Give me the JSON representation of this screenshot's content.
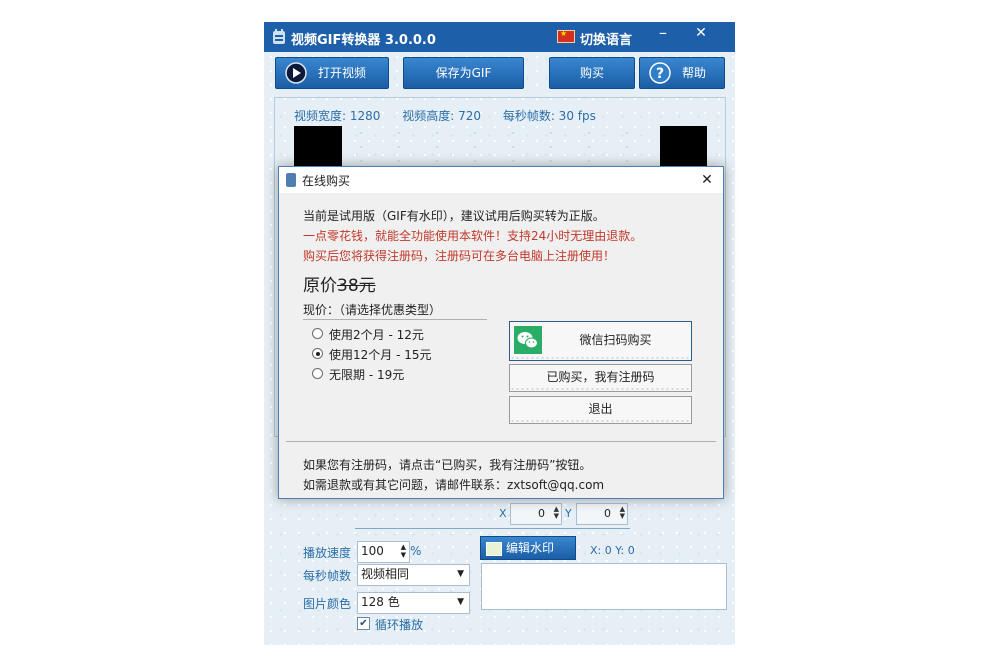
{
  "window": {
    "title": "视频GIF转换器 3.0.0.0",
    "lang_label": "切换语言",
    "minimize_glyph": "–",
    "close_glyph": "✕",
    "flag_color": "#d62e1f"
  },
  "toolbar": {
    "open_label": "打开视频",
    "save_label": "保存为GIF",
    "buy_label": "购买",
    "help_label": "帮助",
    "open_icon": "play-circle-icon",
    "help_icon": "question-circle-icon",
    "accent": "#1a5ea6"
  },
  "video_info": {
    "width_text": "视频宽度: 1280",
    "height_text": "视频高度: 720",
    "fps_text": "每秒帧数: 30 fps"
  },
  "position": {
    "x_label": "X",
    "x_value": "0",
    "y_label": "Y",
    "y_value": "0"
  },
  "settings": {
    "speed_label": "播放速度",
    "speed_value": "100",
    "speed_unit": "%",
    "fps_label": "每秒帧数",
    "fps_value": "视频相同",
    "color_label": "图片颜色",
    "color_value": "128 色",
    "loop_label": "循环播放",
    "loop_checked": true
  },
  "watermark": {
    "button_label": "编辑水印",
    "xy_readout": "X: 0  Y: 0"
  },
  "dialog": {
    "title": "在线购买",
    "line1": "当前是试用版（GIF有水印），建议试用后购买转为正版。",
    "line2": "一点零花钱，就能全功能使用本软件！支持24小时无理由退款。",
    "line3": "购买后您将获得注册码，注册码可在多台电脑上注册使用！",
    "original_price_label": "原价",
    "original_price_amount": "38元",
    "current_price_label": "现价：（请选择优惠类型）",
    "options": [
      {
        "label": "使用2个月 - 12元",
        "selected": false
      },
      {
        "label": "使用12个月 - 15元",
        "selected": true
      },
      {
        "label": "无限期 - 19元",
        "selected": false
      }
    ],
    "wechat_button": "微信扫码购买",
    "have_code_button": "已购买，我有注册码",
    "exit_button": "退出",
    "footer1": "如果您有注册码，请点击“已购买，我有注册码”按钮。",
    "footer2": "如需退款或有其它问题，请邮件联系：zxtsoft@qq.com",
    "warning_color": "#c0392b",
    "wechat_color": "#2aae67"
  }
}
